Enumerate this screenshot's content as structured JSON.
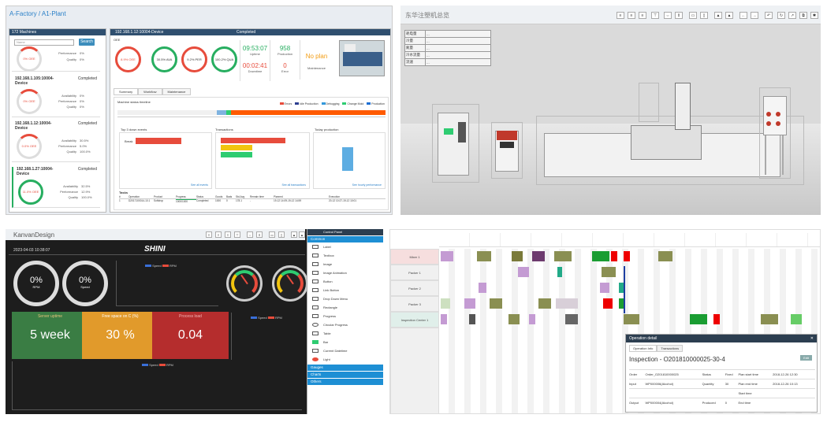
{
  "q1": {
    "breadcrumb": "A-Factory / A1-Plant",
    "left_title": "172 Machines",
    "search_placeholder": "Name",
    "search_btn": "Search",
    "devices": [
      {
        "name": "",
        "status": "",
        "oee": "0% OEE",
        "avail": "",
        "perf": "0%",
        "qual": "0%"
      },
      {
        "name": "192.168.1.105:10004-Device",
        "status": "Completed",
        "oee": "0% OEE",
        "avail": "0%",
        "perf": "0%",
        "qual": "0%"
      },
      {
        "name": "192.168.1.12:10004-Device",
        "status": "Completed",
        "oee": "0.0% OEE",
        "avail": "30.5%",
        "perf": "5.0%",
        "qual": "100.0%"
      },
      {
        "name": "192.168.1.27:10004-Device",
        "status": "Completed",
        "oee": "11.0% OEE",
        "avail": "32.5%",
        "perf": "12.9%",
        "qual": "100.0%"
      }
    ],
    "labels": {
      "avail": "Availability",
      "perf": "Performance",
      "qual": "Quality"
    },
    "detail_head": "192.168.1.12:10004-Device",
    "detail_status": "Completed",
    "oee_label": "OEE",
    "kpis": [
      "8.9% OEE",
      "30.5% AVA",
      "9.2% PER",
      "100.2% QUA"
    ],
    "tiles": [
      {
        "v": "09:53:07",
        "l": "Uptime"
      },
      {
        "v": "958",
        "l": "Production"
      },
      {
        "v": "No plan",
        "l": "Maintenance"
      },
      {
        "v": "00:02:41",
        "l": "Downtime"
      },
      {
        "v": "0",
        "l": "Error"
      }
    ],
    "tabs": [
      "Summary",
      "Workflow",
      "Maintenance"
    ],
    "timeline_title": "Machine status timeline",
    "legend": [
      "Errors",
      "Idle Production",
      "Debugging",
      "Change Mold",
      "Production"
    ],
    "top3": "Top 3 down events",
    "top3_item": "Break",
    "transactions": "Transactions",
    "today": "Today production",
    "see_all": "See all events",
    "see_tr": "See all transactions",
    "see_perf": "See hourly performance",
    "tasks": "Tasks",
    "task_cols": [
      "#",
      "Operation",
      "Product",
      "Progress",
      "Status",
      "Goods",
      "Bads",
      "Std.Avg",
      "Remain time",
      "Planned",
      "Execution"
    ],
    "task_row": [
      "1",
      "D2017100014-10.1",
      "Softdrop",
      "1000/1000",
      "Completed",
      "1000",
      "0",
      "178.1",
      "-",
      "19-12 14:09-19-12 14:59",
      "20-12 10:27-19-12 10:01"
    ]
  },
  "q2": {
    "title": "东华注塑机总览",
    "rows": [
      {
        "k": "耗电量",
        "v": "..."
      },
      {
        "k": "冷量",
        "v": "..."
      },
      {
        "k": "氮量",
        "v": "..."
      },
      {
        "k": "冷水流量",
        "v": "..."
      },
      {
        "k": "流速",
        "v": "..."
      }
    ]
  },
  "q3": {
    "title": "KanvanDesign",
    "date": "2023-04-03 10:38:07",
    "brand": "SHINI",
    "gauges": [
      {
        "v": "0%",
        "l": "RPM"
      },
      {
        "v": "0%",
        "l": "Speed"
      }
    ],
    "legend": [
      "Speed",
      "RPM"
    ],
    "boxes": [
      {
        "h": "Server uptime",
        "v": "5 week",
        "c": "#3a7d44"
      },
      {
        "h": "Free space on C (%)",
        "v": "30 %",
        "c": "#e19a2b"
      },
      {
        "h": "Process load",
        "v": "0.04",
        "c": "#b52d2d"
      }
    ],
    "cp_title": "Control Panel",
    "sections": [
      "Common",
      "Gauges",
      "Charts",
      "Others"
    ],
    "items": [
      "Label",
      "Textbox",
      "Image",
      "Image Animation",
      "Button",
      "Link Button",
      "Drop Down Menu",
      "Rectangle",
      "Progress",
      "Circular Progress",
      "Table",
      "Bar",
      "Current Datetime",
      "Light"
    ]
  },
  "q4": {
    "lanes": [
      "Mixer 1",
      "Packer 1",
      "Packer 2",
      "Packer 3",
      "Inspection Center 1"
    ],
    "dlg_title": "Operation detail",
    "tabs": [
      "Operation Info",
      "Transactions"
    ],
    "op": "Inspection - O201810000025-30-4",
    "edit": "Edit",
    "rows": [
      [
        "Order",
        "Order_O201810000025",
        "Status",
        "Fixed",
        "Plan start time",
        "2018-12-26 12:30"
      ],
      [
        "Input",
        "WP000006(Alcohol)",
        "Quantity",
        "30",
        "Plan end time",
        "2018-12-26 10:13"
      ],
      [
        "",
        "",
        "",
        "",
        "Start time",
        ""
      ],
      [
        "Output",
        "WP000004(Alcohol)",
        "Produced",
        "0",
        "End time",
        ""
      ]
    ]
  }
}
